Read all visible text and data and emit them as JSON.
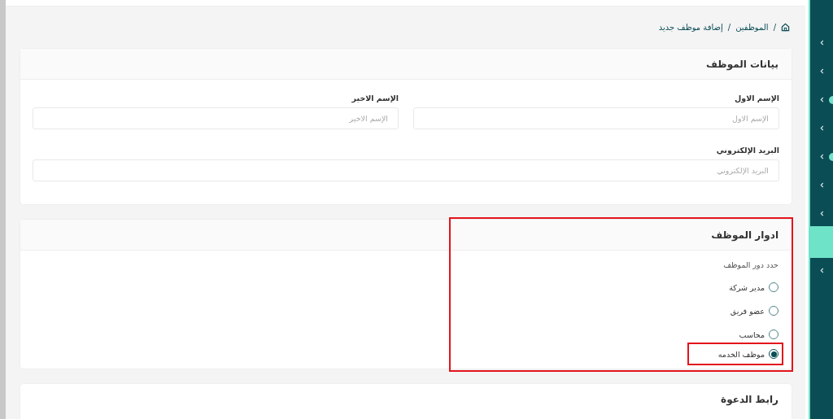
{
  "breadcrumb": {
    "items": [
      "الموظفين",
      "إضافة موظف جديد"
    ],
    "separator": "/"
  },
  "employee_card": {
    "title": "بيانات الموظف",
    "fields": [
      {
        "label": "الإسم الاول",
        "placeholder": "الإسم الاول"
      },
      {
        "label": "الإسم الاخير",
        "placeholder": "الإسم الاخير"
      },
      {
        "label": "البريد الإلكتروني",
        "placeholder": "البريد الإلكتروني"
      }
    ]
  },
  "roles_card": {
    "title": "ادوار الموظف",
    "highlighted": true,
    "prompt": "حدد دور الموظف",
    "options": [
      {
        "label": "مدير شركة",
        "selected": false,
        "highlighted": false
      },
      {
        "label": "عضو فريق",
        "selected": false,
        "highlighted": false
      },
      {
        "label": "محاسب",
        "selected": false,
        "highlighted": false
      },
      {
        "label": "موظف الخدمه",
        "selected": true,
        "highlighted": true
      }
    ]
  },
  "invite_card": {
    "title": "رابط الدعوة"
  },
  "sidebar": {
    "items": [
      {
        "selected": false,
        "dot": false
      },
      {
        "selected": false,
        "dot": false
      },
      {
        "selected": false,
        "dot": true
      },
      {
        "selected": false,
        "dot": false
      },
      {
        "selected": false,
        "dot": true
      },
      {
        "selected": false,
        "dot": false
      },
      {
        "selected": false,
        "dot": false
      },
      {
        "selected": true,
        "dot": false
      },
      {
        "selected": false,
        "dot": false
      }
    ]
  }
}
